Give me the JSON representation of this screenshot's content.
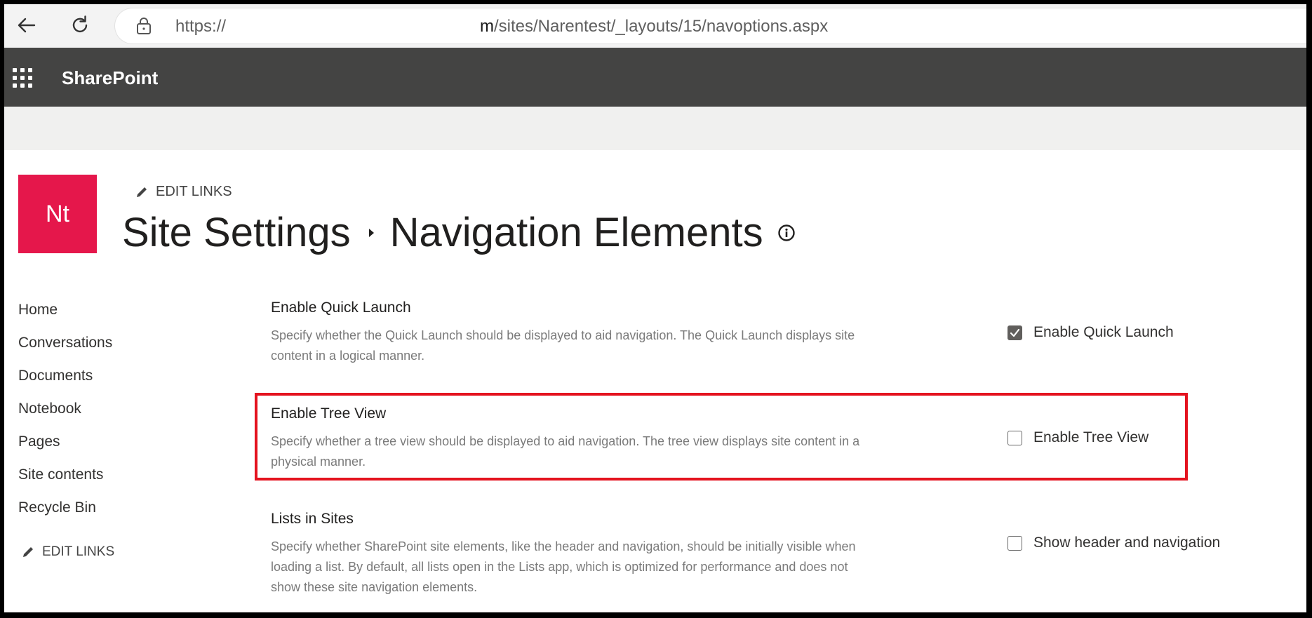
{
  "browser": {
    "url_prefix": "https://",
    "url_domain_suffix": "m",
    "url_path": "/sites/Narentest/_layouts/15/navoptions.aspx"
  },
  "suite": {
    "app_name": "SharePoint"
  },
  "site": {
    "logo_text": "Nt",
    "edit_links": "EDIT LINKS",
    "breadcrumb_parent": "Site Settings",
    "breadcrumb_current": "Navigation Elements"
  },
  "left_nav": {
    "items": [
      "Home",
      "Conversations",
      "Documents",
      "Notebook",
      "Pages",
      "Site contents",
      "Recycle Bin"
    ],
    "edit_links": "EDIT LINKS"
  },
  "sections": [
    {
      "title": "Enable Quick Launch",
      "description": "Specify whether the Quick Launch should be displayed to aid navigation.  The Quick Launch displays site content in a logical manner.",
      "option_label": "Enable Quick Launch",
      "checked": true
    },
    {
      "title": "Enable Tree View",
      "description": "Specify whether a tree view should be displayed to aid navigation.  The tree view displays site content in a physical manner.",
      "option_label": "Enable Tree View",
      "checked": false
    },
    {
      "title": "Lists in Sites",
      "description": "Specify whether SharePoint site elements, like the header and navigation, should be initially visible when loading a list. By default, all lists open in the Lists app, which is optimized for performance and does not show these site navigation elements.",
      "option_label": "Show header and navigation",
      "checked": false
    }
  ],
  "colors": {
    "logo_bg": "#e5174b",
    "suite_bar": "#444443",
    "highlight_border": "#e4131f"
  }
}
